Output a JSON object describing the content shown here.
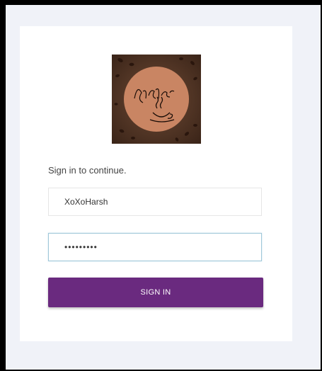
{
  "login": {
    "subtitle": "Sign in to continue.",
    "username_value": "XoXoHarsh",
    "password_value": "pass12345",
    "submit_label": "SIGN IN"
  },
  "colors": {
    "page_background": "#f0f2f8",
    "card_background": "#ffffff",
    "button_background": "#6a2a7f",
    "button_text": "#ffffff",
    "focus_border": "#9fc7d8"
  },
  "icons": [
    "coffee-logo"
  ]
}
